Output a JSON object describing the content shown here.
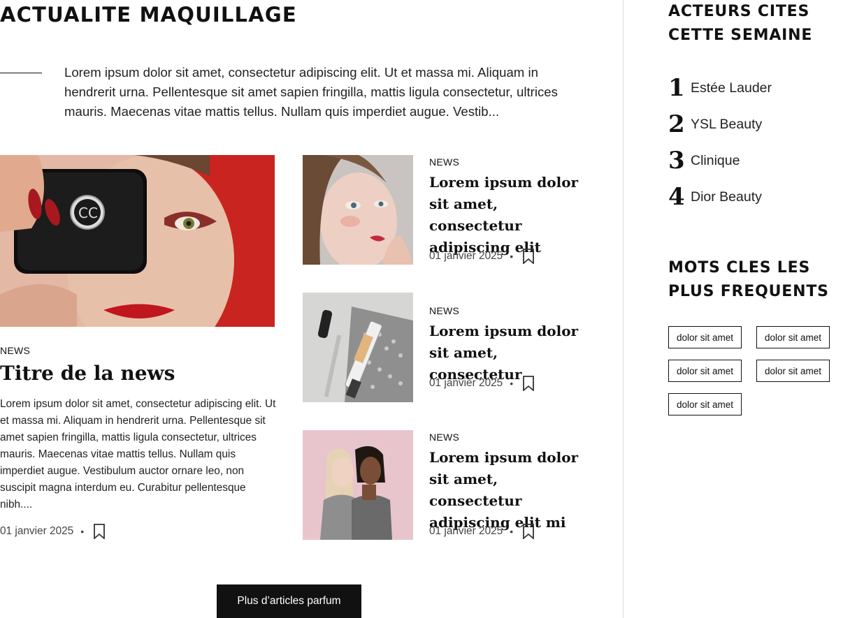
{
  "main": {
    "section_title": "ACTUALITE MAQUILLAGE",
    "intro": "Lorem ipsum dolor sit amet, consectetur adipiscing elit. Ut et massa mi. Aliquam in hendrerit urna. Pellentesque sit amet sapien fringilla, mattis ligula consectetur, ultrices mauris. Maecenas vitae mattis tellus. Nullam quis imperdiet augue. Vestib...",
    "featured": {
      "tag": "NEWS",
      "title": "Titre de la news",
      "excerpt": "Lorem ipsum dolor sit amet, consectetur adipiscing elit. Ut et massa mi. Aliquam in hendrerit urna. Pellentesque sit amet sapien fringilla, mattis ligula consectetur, ultrices mauris. Maecenas vitae mattis tellus. Nullam quis imperdiet augue. Vestibulum auctor ornare leo, non suscipit magna interdum eu. Curabitur pellentesque nibh....",
      "date": "01 janvier 2025",
      "separator": "•",
      "bookmark_icon": "bookmark-icon"
    },
    "cards": [
      {
        "tag": "NEWS",
        "title": "Lorem ipsum dolor sit amet, consectetur adipiscing elit",
        "date": "01 janvier 2025",
        "separator": "•"
      },
      {
        "tag": "NEWS",
        "title": "Lorem ipsum dolor sit amet, consectetur",
        "date": "01 janvier 2025",
        "separator": "•"
      },
      {
        "tag": "NEWS",
        "title": "Lorem ipsum dolor sit amet, consectetur adipiscing elit mi",
        "date": "01 janvier 2025",
        "separator": "•"
      }
    ],
    "more_button": "Plus d’articles parfum"
  },
  "sidebar": {
    "actors_title": "ACTEURS CITES CETTE SEMAINE",
    "actors": [
      {
        "rank": "1",
        "name": "Estée Lauder"
      },
      {
        "rank": "2",
        "name": "YSL Beauty"
      },
      {
        "rank": "3",
        "name": "Clinique"
      },
      {
        "rank": "4",
        "name": "Dior Beauty"
      }
    ],
    "keywords_title": "MOTS CLES LES PLUS FREQUENTS",
    "keywords": [
      "dolor sit amet",
      "dolor sit amet",
      "dolor sit amet",
      "dolor sit amet",
      "dolor sit amet"
    ]
  },
  "colors": {
    "text": "#111111",
    "button_bg": "#111111",
    "button_text": "#ffffff",
    "divider": "#dcdcdc"
  }
}
